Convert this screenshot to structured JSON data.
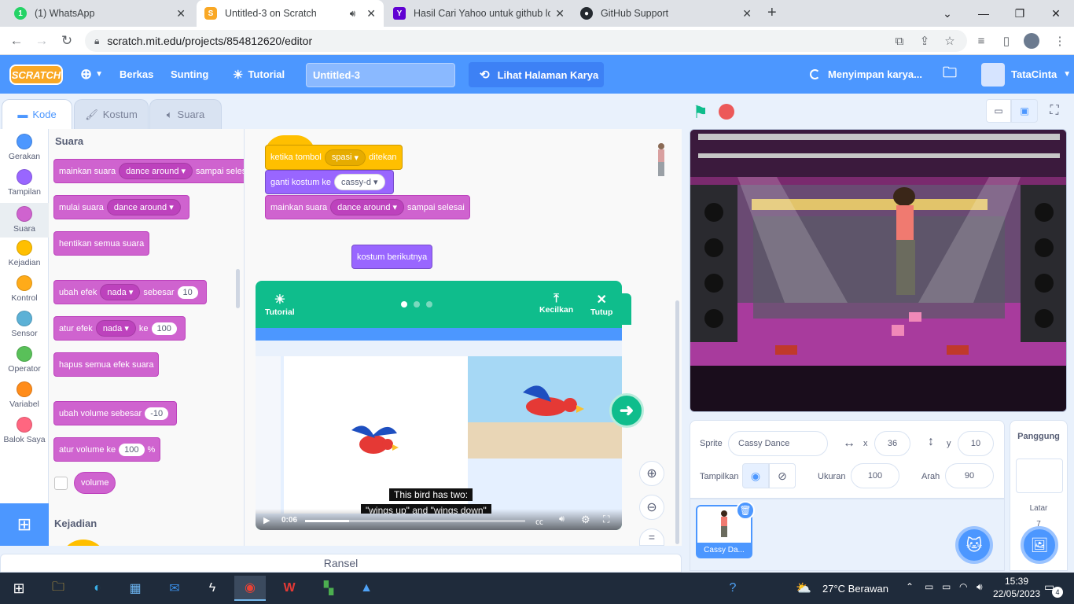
{
  "browser": {
    "tabs": [
      {
        "title": "(1) WhatsApp",
        "icon": "whatsapp-icon",
        "color": "#25d366"
      },
      {
        "title": "Untitled-3 on Scratch",
        "icon": "scratch-icon",
        "color": "#f9a825"
      },
      {
        "title": "Hasil Cari Yahoo untuk github log",
        "icon": "yahoo-icon",
        "color": "#6001d2"
      },
      {
        "title": "GitHub Support",
        "icon": "github-icon",
        "color": "#24292f"
      }
    ],
    "url": "scratch.mit.edu/projects/854812620/editor"
  },
  "menu": {
    "logo": "SCRATCH",
    "file": "Berkas",
    "edit": "Sunting",
    "tutorial": "Tutorial",
    "project_title": "Untitled-3",
    "see_project": "Lihat Halaman Karya",
    "saving": "Menyimpan karya...",
    "user": "TataCinta"
  },
  "editor_tabs": {
    "code": "Kode",
    "costume": "Kostum",
    "sound": "Suara"
  },
  "categories": [
    {
      "label": "Gerakan",
      "color": "#4c97ff"
    },
    {
      "label": "Tampilan",
      "color": "#9966ff"
    },
    {
      "label": "Suara",
      "color": "#cf63cf"
    },
    {
      "label": "Kejadian",
      "color": "#ffbf00"
    },
    {
      "label": "Kontrol",
      "color": "#ffab19"
    },
    {
      "label": "Sensor",
      "color": "#5cb1d6"
    },
    {
      "label": "Operator",
      "color": "#59c059"
    },
    {
      "label": "Variabel",
      "color": "#ff8c1a"
    },
    {
      "label": "Balok Saya",
      "color": "#ff6680"
    }
  ],
  "palette": {
    "heading": "Suara",
    "play_until": {
      "a": "mainkan suara",
      "sound": "dance around",
      "b": "sampai selesai"
    },
    "start_sound": {
      "a": "mulai suara",
      "sound": "dance around"
    },
    "stop_all": "hentikan semua suara",
    "change_effect": {
      "a": "ubah efek",
      "effect": "nada",
      "b": "sebesar",
      "val": "10"
    },
    "set_effect": {
      "a": "atur efek",
      "effect": "nada",
      "b": "ke",
      "val": "100"
    },
    "clear_effects": "hapus semua efek suara",
    "change_volume": {
      "a": "ubah volume sebesar",
      "val": "-10"
    },
    "set_volume": {
      "a": "atur volume ke",
      "val": "100",
      "unit": "%"
    },
    "volume": "volume",
    "next_heading": "Kejadian"
  },
  "script": {
    "hat": {
      "a": "ketika tombol",
      "key": "spasi",
      "b": "ditekan"
    },
    "switch": {
      "a": "ganti kostum ke",
      "costume": "cassy-d"
    },
    "play": {
      "a": "mainkan suara",
      "sound": "dance around",
      "b": "sampai selesai"
    },
    "next": "kostum berikutnya"
  },
  "tutorial": {
    "label": "Tutorial",
    "shrink": "Kecilkan",
    "close": "Tutup",
    "caption1": "This bird has two:",
    "caption2": "\"wings up\" and \"wings down\"",
    "time": "0:06",
    "progress": 0.2
  },
  "sprite": {
    "label": "Sprite",
    "name": "Cassy Dance",
    "x_label": "x",
    "x": "36",
    "y_label": "y",
    "y": "10",
    "show_label": "Tampilkan",
    "size_label": "Ukuran",
    "size": "100",
    "dir_label": "Arah",
    "dir": "90",
    "thumb_name": "Cassy Da..."
  },
  "stage_panel": {
    "label": "Panggung",
    "backdrops_label": "Latar",
    "backdrops_count": "7"
  },
  "backpack": "Ransel",
  "taskbar": {
    "weather": "27°C Berawan",
    "time": "15:39",
    "date": "22/05/2023",
    "notifications": "4"
  }
}
